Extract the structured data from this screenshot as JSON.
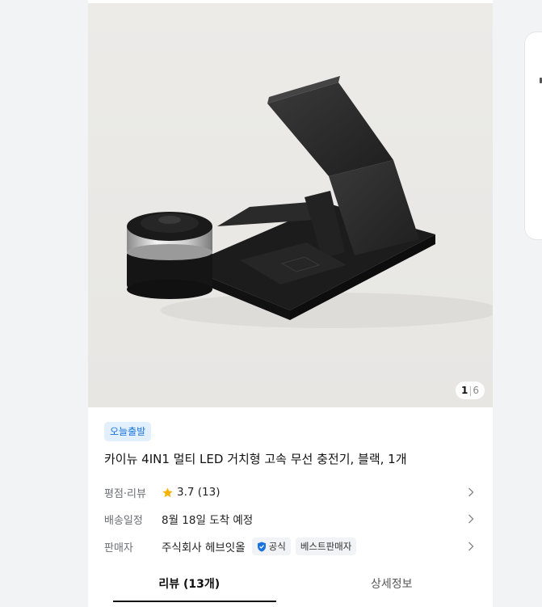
{
  "gallery": {
    "current": "1",
    "total": "6"
  },
  "product": {
    "badge": "오늘출발",
    "title": "카이뉴 4IN1 멀티 LED 거치형 고속 무선 충전기, 블랙, 1개"
  },
  "info": {
    "rating": {
      "label": "평점·리뷰",
      "score": "3.7",
      "count": "(13)",
      "stars_color": "#f6b200"
    },
    "delivery": {
      "label": "배송일정",
      "value": "8월 18일 도착 예정"
    },
    "seller": {
      "label": "판매자",
      "name": "주식회사 헤브잇올",
      "official_tag": "공식",
      "best_tag": "베스트판매자",
      "official_color": "#1b73de"
    }
  },
  "tabs": [
    {
      "label": "리뷰 (13개)"
    },
    {
      "label": "상세정보"
    }
  ]
}
